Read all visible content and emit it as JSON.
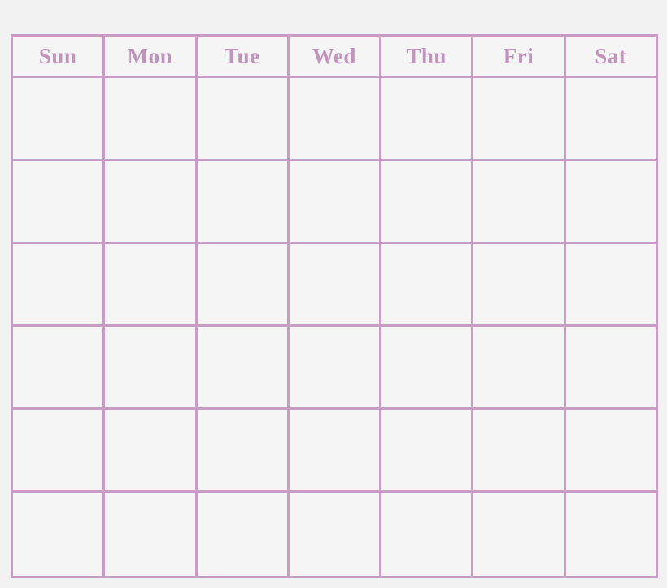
{
  "page": {
    "title": "Blank Monthly Calendar Grid",
    "background_color": "#f2f2f2"
  },
  "calendar": {
    "grid_line_color": "#c89cc4",
    "cell_background_color": "#f5f5f5",
    "header_text_color": "#c194bd",
    "columns": 7,
    "body_rows": 6,
    "day_headers": [
      {
        "label": "Sun"
      },
      {
        "label": "Mon"
      },
      {
        "label": "Tue"
      },
      {
        "label": "Wed"
      },
      {
        "label": "Thu"
      },
      {
        "label": "Fri"
      },
      {
        "label": "Sat"
      }
    ],
    "weeks": [
      {
        "days": [
          {
            "label": ""
          },
          {
            "label": ""
          },
          {
            "label": ""
          },
          {
            "label": ""
          },
          {
            "label": ""
          },
          {
            "label": ""
          },
          {
            "label": ""
          }
        ]
      },
      {
        "days": [
          {
            "label": ""
          },
          {
            "label": ""
          },
          {
            "label": ""
          },
          {
            "label": ""
          },
          {
            "label": ""
          },
          {
            "label": ""
          },
          {
            "label": ""
          }
        ]
      },
      {
        "days": [
          {
            "label": ""
          },
          {
            "label": ""
          },
          {
            "label": ""
          },
          {
            "label": ""
          },
          {
            "label": ""
          },
          {
            "label": ""
          },
          {
            "label": ""
          }
        ]
      },
      {
        "days": [
          {
            "label": ""
          },
          {
            "label": ""
          },
          {
            "label": ""
          },
          {
            "label": ""
          },
          {
            "label": ""
          },
          {
            "label": ""
          },
          {
            "label": ""
          }
        ]
      },
      {
        "days": [
          {
            "label": ""
          },
          {
            "label": ""
          },
          {
            "label": ""
          },
          {
            "label": ""
          },
          {
            "label": ""
          },
          {
            "label": ""
          },
          {
            "label": ""
          }
        ]
      },
      {
        "days": [
          {
            "label": ""
          },
          {
            "label": ""
          },
          {
            "label": ""
          },
          {
            "label": ""
          },
          {
            "label": ""
          },
          {
            "label": ""
          },
          {
            "label": ""
          }
        ]
      }
    ]
  }
}
